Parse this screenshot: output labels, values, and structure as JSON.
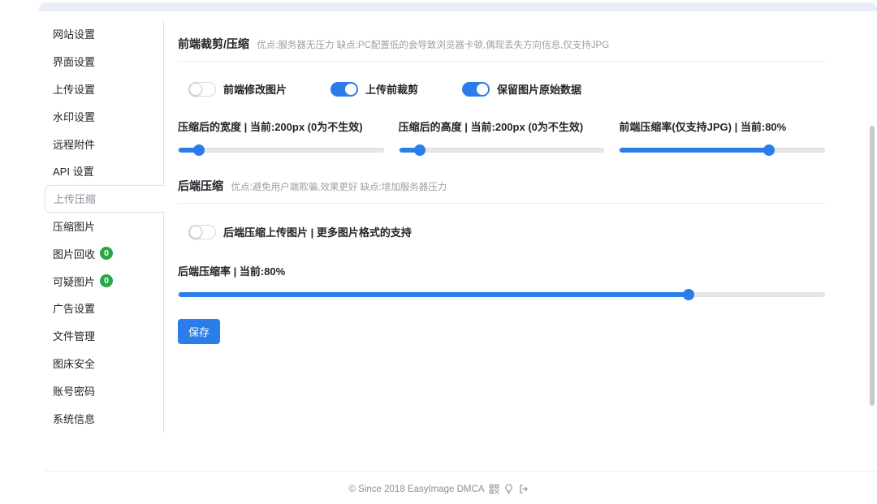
{
  "sidebar": {
    "items": [
      {
        "label": "网站设置",
        "active": false
      },
      {
        "label": "界面设置",
        "active": false
      },
      {
        "label": "上传设置",
        "active": false
      },
      {
        "label": "水印设置",
        "active": false
      },
      {
        "label": "远程附件",
        "active": false
      },
      {
        "label": "API 设置",
        "active": false
      },
      {
        "label": "上传压缩",
        "active": true
      },
      {
        "label": "压缩图片",
        "active": false
      },
      {
        "label": "图片回收",
        "active": false,
        "badge": "0"
      },
      {
        "label": "可疑图片",
        "active": false,
        "badge": "0"
      },
      {
        "label": "广告设置",
        "active": false
      },
      {
        "label": "文件管理",
        "active": false
      },
      {
        "label": "图床安全",
        "active": false
      },
      {
        "label": "账号密码",
        "active": false
      },
      {
        "label": "系统信息",
        "active": false
      }
    ]
  },
  "frontend_section": {
    "title": "前端裁剪/压缩",
    "description": "优点:服务器无压力 缺点:PC配置低的会导致浏览器卡顿,偶现丢失方向信息,仅支持JPG",
    "toggles": [
      {
        "label": "前端修改图片",
        "on": false
      },
      {
        "label": "上传前裁剪",
        "on": true
      },
      {
        "label": "保留图片原始数据",
        "on": true
      }
    ],
    "sliders": [
      {
        "label": "压缩后的宽度 | 当前:200px (0为不生效)",
        "current_value": "200px",
        "position_percent": 10
      },
      {
        "label": "压缩后的高度 | 当前:200px (0为不生效)",
        "current_value": "200px",
        "position_percent": 10
      },
      {
        "label": "前端压缩率(仅支持JPG) | 当前:80%",
        "current_value": "80%",
        "position_percent": 73
      }
    ]
  },
  "backend_section": {
    "title": "后端压缩",
    "description": "优点:避免用户端欺骗,效果更好 缺点:增加服务器压力",
    "toggle": {
      "label": "后端压缩上传图片 | 更多图片格式的支持",
      "on": false
    },
    "slider": {
      "label": "后端压缩率 | 当前:80%",
      "current_value": "80%",
      "position_percent": 79
    }
  },
  "save_button": {
    "label": "保存"
  },
  "footer": {
    "text": "© Since 2018 EasyImage DMCA",
    "icons": [
      "qr-code-icon",
      "lightbulb-icon",
      "logout-icon"
    ]
  },
  "colors": {
    "primary": "#2b7de9",
    "badge_green": "#28a745"
  }
}
